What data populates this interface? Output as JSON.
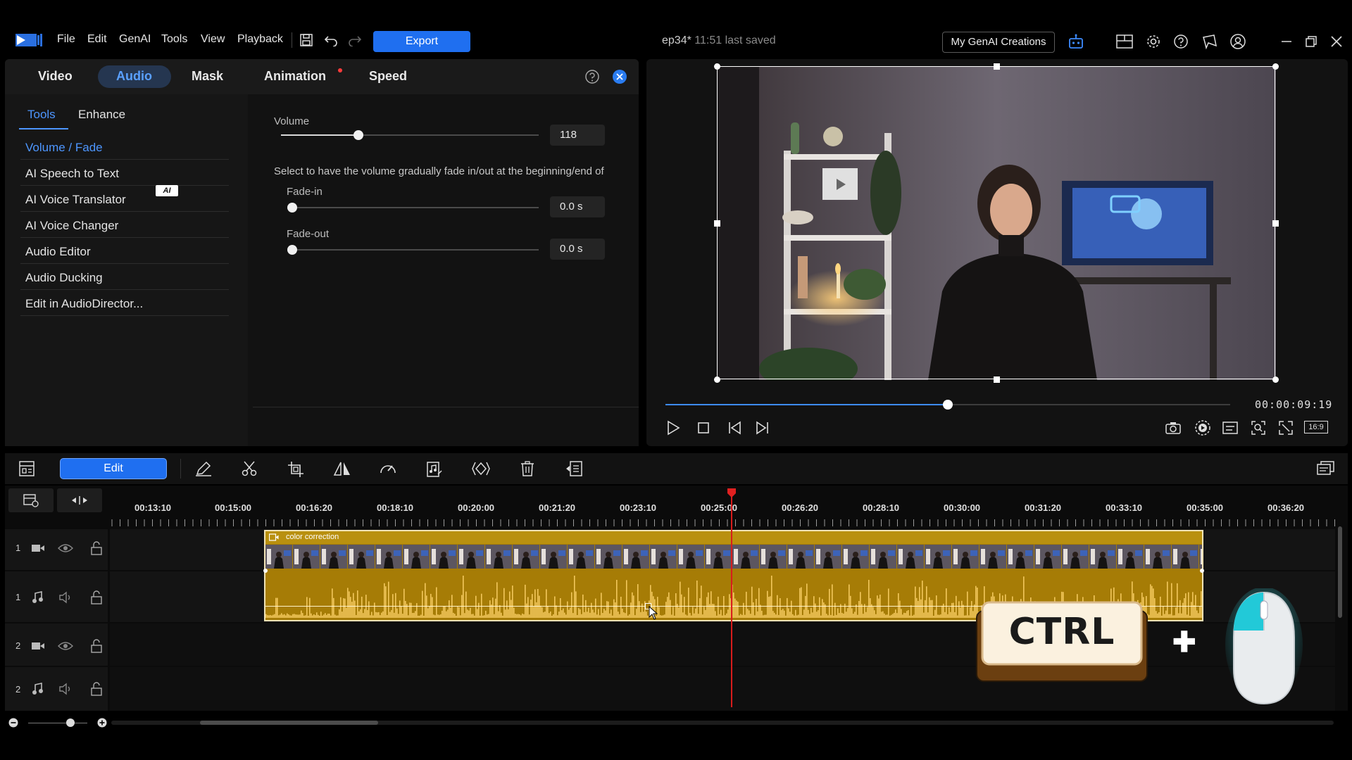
{
  "menu": {
    "items": [
      "File",
      "Edit",
      "GenAI",
      "Tools",
      "View",
      "Playback"
    ],
    "export_label": "Export"
  },
  "document": {
    "title": "ep34*",
    "saved_status": "11:51 last saved"
  },
  "topright": {
    "genai_creations_label": "My GenAI Creations"
  },
  "panel": {
    "tabs": [
      "Video",
      "Audio",
      "Mask",
      "Animation",
      "Speed"
    ],
    "active_tab": "Audio",
    "subtabs": [
      "Tools",
      "Enhance"
    ],
    "active_subtab": "Tools",
    "tools": [
      "Volume / Fade",
      "AI Speech to Text",
      "AI Voice Translator",
      "AI Voice Changer",
      "Audio Editor",
      "Audio Ducking",
      "Edit in AudioDirector..."
    ],
    "active_tool": "Volume / Fade",
    "ai_badge": "AI",
    "volume_label": "Volume",
    "volume_value": "118",
    "volume_level": 0.3,
    "fade_description": "Select to have the volume gradually fade in/out at the beginning/end of",
    "fade_in_label": "Fade-in",
    "fade_in_value": "0.0 s",
    "fade_out_label": "Fade-out",
    "fade_out_value": "0.0 s"
  },
  "preview": {
    "timecode": "00:00:09:19",
    "progress": 0.5,
    "aspect_label": "16:9"
  },
  "timeline": {
    "edit_label": "Edit",
    "ruler": [
      "00:13:10",
      "00:15:00",
      "00:16:20",
      "00:18:10",
      "00:20:00",
      "00:21:20",
      "00:23:10",
      "00:25:00",
      "00:26:20",
      "00:28:10",
      "00:30:00",
      "00:31:20",
      "00:33:10",
      "00:35:00",
      "00:36:20"
    ],
    "tracks": [
      {
        "num": "1",
        "kind": "video"
      },
      {
        "num": "1",
        "kind": "audio"
      },
      {
        "num": "2",
        "kind": "video"
      },
      {
        "num": "2",
        "kind": "audio"
      }
    ],
    "clip_label": "color correction"
  },
  "overlay": {
    "key_label": "CTRL",
    "plus": "✚"
  },
  "colors": {
    "accent": "#1f6ff0",
    "clip": "#b8860b",
    "waveform": "#f2c75c",
    "playhead": "#e02020"
  }
}
